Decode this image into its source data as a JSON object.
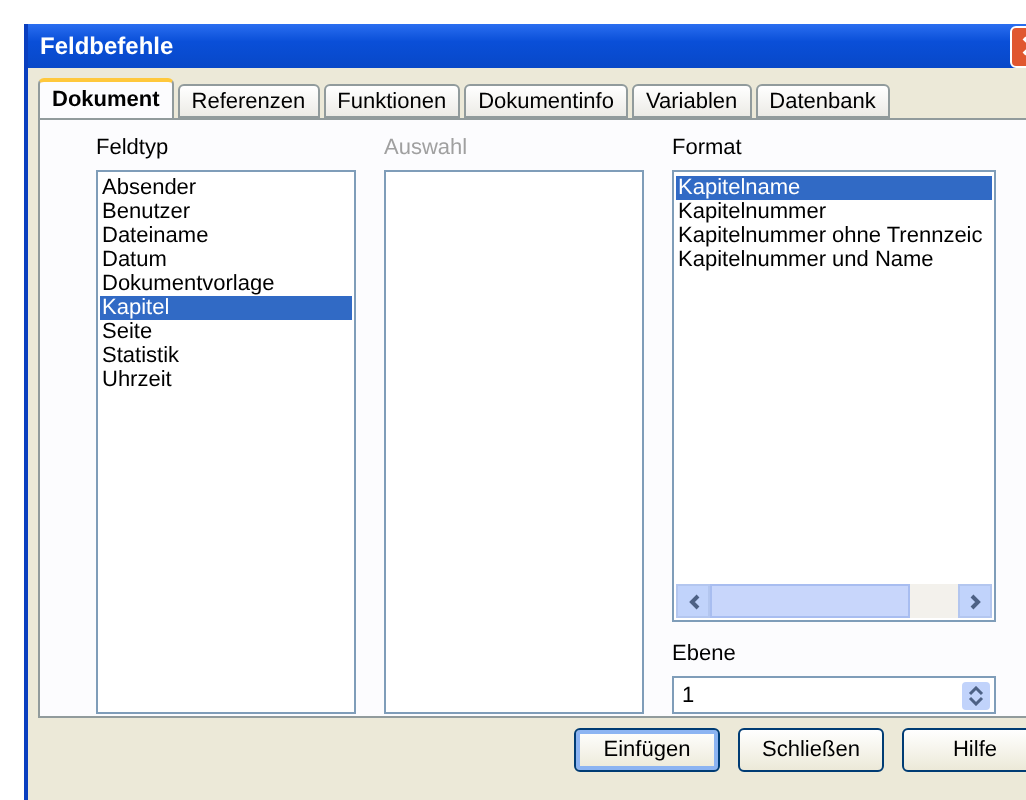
{
  "window": {
    "title": "Feldbefehle"
  },
  "tabs": [
    {
      "label": "Dokument",
      "selected": true
    },
    {
      "label": "Referenzen",
      "selected": false
    },
    {
      "label": "Funktionen",
      "selected": false
    },
    {
      "label": "Dokumentinfo",
      "selected": false
    },
    {
      "label": "Variablen",
      "selected": false
    },
    {
      "label": "Datenbank",
      "selected": false
    }
  ],
  "feldtyp": {
    "label": "Feldtyp",
    "disabled": false,
    "items": [
      {
        "label": "Absender",
        "selected": false
      },
      {
        "label": "Benutzer",
        "selected": false
      },
      {
        "label": "Dateiname",
        "selected": false
      },
      {
        "label": "Datum",
        "selected": false
      },
      {
        "label": "Dokumentvorlage",
        "selected": false
      },
      {
        "label": "Kapitel",
        "selected": true
      },
      {
        "label": "Seite",
        "selected": false
      },
      {
        "label": "Statistik",
        "selected": false
      },
      {
        "label": "Uhrzeit",
        "selected": false
      }
    ]
  },
  "auswahl": {
    "label": "Auswahl",
    "disabled": true
  },
  "format": {
    "label": "Format",
    "items": [
      {
        "label": "Kapitelname",
        "selected": true
      },
      {
        "label": "Kapitelnummer",
        "selected": false
      },
      {
        "label": "Kapitelnummer ohne Trennzeic",
        "selected": false
      },
      {
        "label": "Kapitelnummer und Name",
        "selected": false
      }
    ]
  },
  "ebene": {
    "label": "Ebene",
    "value": "1"
  },
  "buttons": [
    {
      "label": "Einfügen",
      "default": true
    },
    {
      "label": "Schließen",
      "default": false
    },
    {
      "label": "Hilfe",
      "default": false
    }
  ]
}
